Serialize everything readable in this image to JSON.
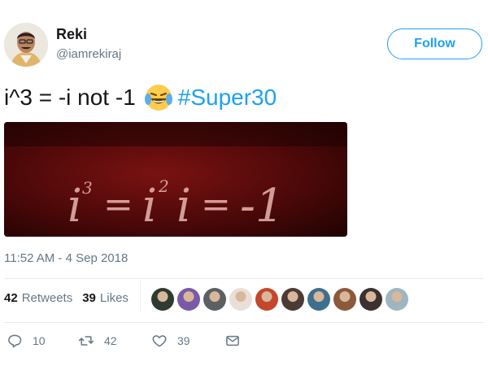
{
  "user": {
    "display_name": "Reki",
    "handle": "@iamrekiraj",
    "avatar_icon": "profile-photo"
  },
  "follow_button": {
    "label": "Follow",
    "color": "#1da1f2"
  },
  "tweet": {
    "text": "i^3 = -i not -1",
    "emoji": "face-with-tears-of-joy",
    "hashtag": "#Super30",
    "media": {
      "alt_text": "i³ = i²i = -1",
      "chalk_text": {
        "a": "i",
        "b": "3",
        "c": "=",
        "d": "i",
        "e": "2",
        "f": "i",
        "g": "=",
        "h": "-1"
      }
    },
    "timestamp": "11:52 AM - 4 Sep 2018"
  },
  "stats": {
    "retweets_count": "42",
    "retweets_label": "Retweets",
    "likes_count": "39",
    "likes_label": "Likes"
  },
  "likers": [
    {
      "name": "liker-1",
      "color": "#2f3a30"
    },
    {
      "name": "liker-2",
      "color": "#7a5aa8"
    },
    {
      "name": "liker-3",
      "color": "#5c5f63"
    },
    {
      "name": "liker-4",
      "color": "#e9dfd6"
    },
    {
      "name": "liker-5",
      "color": "#c4472c"
    },
    {
      "name": "liker-6",
      "color": "#4b3b35"
    },
    {
      "name": "liker-7",
      "color": "#3f6f8f"
    },
    {
      "name": "liker-8",
      "color": "#8a5a3a"
    },
    {
      "name": "liker-9",
      "color": "#3b3130"
    },
    {
      "name": "liker-10",
      "color": "#9fb5c2"
    }
  ],
  "actions": {
    "reply_count": "10",
    "retweet_count": "42",
    "like_count": "39"
  }
}
